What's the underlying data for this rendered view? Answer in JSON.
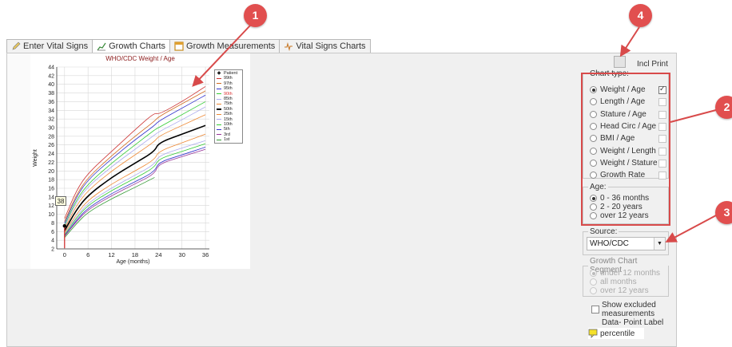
{
  "tabs": [
    {
      "label": "Enter Vital Signs",
      "icon": "pencil-icon",
      "active": false
    },
    {
      "label": "Growth Charts",
      "icon": "growth-chart-icon",
      "active": true
    },
    {
      "label": "Growth Measurements",
      "icon": "table-icon",
      "active": false
    },
    {
      "label": "Vital Signs Charts",
      "icon": "vitals-chart-icon",
      "active": false
    }
  ],
  "incl_print": {
    "label": "Incl Print",
    "checked": false
  },
  "chart_type": {
    "title": "Chart type:",
    "options": [
      {
        "label": "Weight / Age",
        "selected": true,
        "checked": true
      },
      {
        "label": "Length / Age",
        "selected": false,
        "checked": false
      },
      {
        "label": "Stature / Age",
        "selected": false,
        "checked": false
      },
      {
        "label": "Head Circ / Age",
        "selected": false,
        "checked": false
      },
      {
        "label": "BMI / Age",
        "selected": false,
        "checked": false
      },
      {
        "label": "Weight / Length",
        "selected": false,
        "checked": false
      },
      {
        "label": "Weight / Stature",
        "selected": false,
        "checked": false
      },
      {
        "label": "Growth Rate",
        "selected": false,
        "checked": false
      }
    ]
  },
  "age": {
    "title": "Age:",
    "options": [
      {
        "label": "0 - 36 months",
        "selected": true
      },
      {
        "label": "2 - 20 years",
        "selected": false
      },
      {
        "label": "over 12 years",
        "selected": false
      }
    ]
  },
  "source": {
    "title": "Source:",
    "value": "WHO/CDC"
  },
  "segment": {
    "title": "Growth Chart Segment",
    "options": [
      {
        "label": "under 12 months",
        "selected": true
      },
      {
        "label": "all months",
        "selected": false
      },
      {
        "label": "over 12 years",
        "selected": false
      }
    ]
  },
  "show_excluded": {
    "label_lines": [
      "Show excluded",
      "measurements"
    ],
    "checked": false
  },
  "data_point_label": {
    "title": "Data- Point Label",
    "value": "percentile"
  },
  "markers": [
    "1",
    "2",
    "3",
    "4"
  ],
  "tooltip_value": "38",
  "colors": {
    "annotation_red": "#d84a4a",
    "marker_red": "#e14f4f",
    "chart_title": "#8b1a1a"
  },
  "chart_data": {
    "type": "line",
    "title": "WHO/CDC Weight / Age",
    "xlabel": "Age (months)",
    "ylabel": "Weight",
    "xlim": [
      -2,
      37
    ],
    "ylim": [
      2,
      44
    ],
    "xticks": [
      0,
      6,
      12,
      18,
      24,
      30,
      36
    ],
    "yticks": [
      2,
      4,
      6,
      8,
      10,
      12,
      14,
      16,
      18,
      20,
      22,
      24,
      26,
      28,
      30,
      32,
      34,
      36,
      38,
      40,
      42,
      44
    ],
    "grid": true,
    "legend_position": "top-right",
    "patient": {
      "name": "Patient",
      "points": [
        [
          0,
          7.3
        ]
      ]
    },
    "series": [
      {
        "name": "99th",
        "color": "#cc3333",
        "points": [
          [
            0,
            9.0
          ],
          [
            3,
            15.5
          ],
          [
            6,
            19.5
          ],
          [
            12,
            24.5
          ],
          [
            18,
            29.5
          ],
          [
            23,
            33.5
          ],
          [
            24,
            33.0
          ],
          [
            30,
            36.0
          ],
          [
            36,
            39.5
          ]
        ]
      },
      {
        "name": "97th",
        "color": "#d2691e",
        "points": [
          [
            0,
            8.3
          ],
          [
            3,
            14.5
          ],
          [
            6,
            18.5
          ],
          [
            12,
            23.5
          ],
          [
            18,
            28.0
          ],
          [
            23,
            31.5
          ],
          [
            24,
            32.5
          ],
          [
            30,
            35.5
          ],
          [
            36,
            38.5
          ]
        ]
      },
      {
        "name": "95th",
        "color": "#3333cc",
        "points": [
          [
            0,
            7.9
          ],
          [
            3,
            14.0
          ],
          [
            6,
            18.0
          ],
          [
            12,
            22.8
          ],
          [
            18,
            27.2
          ],
          [
            23,
            30.5
          ],
          [
            24,
            31.5
          ],
          [
            30,
            34.5
          ],
          [
            36,
            37.5
          ]
        ]
      },
      {
        "name": "90th",
        "color": "#33cc33",
        "points": [
          [
            0,
            7.4
          ],
          [
            3,
            13.3
          ],
          [
            6,
            17.0
          ],
          [
            12,
            21.8
          ],
          [
            18,
            26.0
          ],
          [
            23,
            29.5
          ],
          [
            24,
            30.0
          ],
          [
            30,
            33.0
          ],
          [
            36,
            36.0
          ]
        ]
      },
      {
        "name": "85th",
        "color": "#aaaaee",
        "points": [
          [
            0,
            7.1
          ],
          [
            3,
            12.8
          ],
          [
            6,
            16.4
          ],
          [
            12,
            21.0
          ],
          [
            18,
            25.0
          ],
          [
            23,
            28.3
          ],
          [
            24,
            29.0
          ],
          [
            30,
            31.8
          ],
          [
            36,
            34.8
          ]
        ]
      },
      {
        "name": "75th",
        "color": "#ee8833",
        "points": [
          [
            0,
            6.7
          ],
          [
            3,
            12.0
          ],
          [
            6,
            15.5
          ],
          [
            12,
            20.0
          ],
          [
            18,
            23.7
          ],
          [
            23,
            26.8
          ],
          [
            24,
            28.0
          ],
          [
            30,
            30.5
          ],
          [
            36,
            33.0
          ]
        ]
      },
      {
        "name": "50th",
        "color": "#000000",
        "points": [
          [
            0,
            6.2
          ],
          [
            3,
            11.0
          ],
          [
            6,
            14.4
          ],
          [
            12,
            18.5
          ],
          [
            18,
            21.8
          ],
          [
            23,
            24.5
          ],
          [
            24,
            26.5
          ],
          [
            30,
            28.5
          ],
          [
            36,
            30.5
          ]
        ]
      },
      {
        "name": "25th",
        "color": "#ee8833",
        "points": [
          [
            0,
            5.7
          ],
          [
            3,
            10.0
          ],
          [
            6,
            13.3
          ],
          [
            12,
            17.0
          ],
          [
            18,
            20.0
          ],
          [
            23,
            22.6
          ],
          [
            24,
            24.5
          ],
          [
            30,
            26.5
          ],
          [
            36,
            28.5
          ]
        ]
      },
      {
        "name": "15th",
        "color": "#aaaaee",
        "points": [
          [
            0,
            5.4
          ],
          [
            3,
            9.5
          ],
          [
            6,
            12.6
          ],
          [
            12,
            16.1
          ],
          [
            18,
            19.0
          ],
          [
            23,
            21.5
          ],
          [
            24,
            23.5
          ],
          [
            30,
            25.3
          ],
          [
            36,
            27.0
          ]
        ]
      },
      {
        "name": "10th",
        "color": "#33cc33",
        "points": [
          [
            0,
            5.2
          ],
          [
            3,
            9.1
          ],
          [
            6,
            12.1
          ],
          [
            12,
            15.5
          ],
          [
            18,
            18.3
          ],
          [
            23,
            20.8
          ],
          [
            24,
            22.8
          ],
          [
            30,
            24.5
          ],
          [
            36,
            26.3
          ]
        ]
      },
      {
        "name": "5th",
        "color": "#3333cc",
        "points": [
          [
            0,
            5.0
          ],
          [
            3,
            8.6
          ],
          [
            6,
            11.5
          ],
          [
            12,
            14.8
          ],
          [
            18,
            17.5
          ],
          [
            23,
            19.8
          ],
          [
            24,
            22.0
          ],
          [
            30,
            23.7
          ],
          [
            36,
            25.5
          ]
        ]
      },
      {
        "name": "3rd",
        "color": "#993399",
        "points": [
          [
            0,
            4.9
          ],
          [
            3,
            8.3
          ],
          [
            6,
            11.1
          ],
          [
            12,
            14.3
          ],
          [
            18,
            17.0
          ],
          [
            23,
            19.3
          ],
          [
            24,
            21.6
          ],
          [
            30,
            23.3
          ],
          [
            36,
            25.0
          ]
        ]
      },
      {
        "name": "1st",
        "color": "#339933",
        "points": [
          [
            0,
            4.6
          ],
          [
            3,
            7.8
          ],
          [
            6,
            10.5
          ],
          [
            12,
            13.6
          ],
          [
            18,
            16.2
          ],
          [
            23,
            18.5
          ]
        ]
      }
    ]
  }
}
